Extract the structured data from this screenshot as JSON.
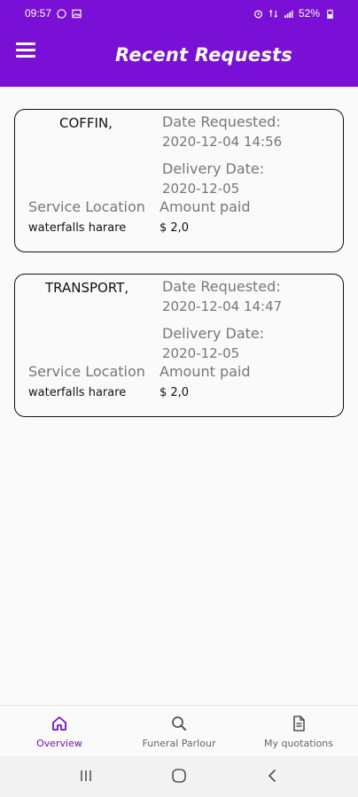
{
  "status_bar": {
    "time": "09:57",
    "battery": "52%",
    "icons_left": [
      "phone-icon",
      "whatsapp-icon",
      "image-icon"
    ],
    "icons_right": [
      "alarm-icon",
      "network-icon",
      "signal-icon",
      "battery-icon"
    ]
  },
  "app_bar": {
    "title": "Recent Requests",
    "menu_icon": "hamburger-menu-icon"
  },
  "requests": [
    {
      "service": "COFFIN,",
      "date_requested_label": "Date Requested:",
      "date_requested": "2020-12-04 14:56",
      "delivery_date_label": "Delivery Date:",
      "delivery_date": "2020-12-05",
      "service_location_label": "Service Location",
      "service_location": "waterfalls harare",
      "amount_paid_label": "Amount paid",
      "amount_paid": "$ 2,0"
    },
    {
      "service": "TRANSPORT,",
      "date_requested_label": "Date Requested:",
      "date_requested": "2020-12-04 14:47",
      "delivery_date_label": "Delivery Date:",
      "delivery_date": "2020-12-05",
      "service_location_label": "Service Location",
      "service_location": "waterfalls harare",
      "amount_paid_label": "Amount paid",
      "amount_paid": "$ 2,0"
    }
  ],
  "bottom_nav": {
    "items": [
      {
        "label": "Overview",
        "icon": "home-icon",
        "active": true
      },
      {
        "label": "Funeral Parlour",
        "icon": "search-icon",
        "active": false
      },
      {
        "label": "My quotations",
        "icon": "document-icon",
        "active": false
      }
    ]
  },
  "colors": {
    "primary": "#7a0fd6",
    "background": "#fafafa",
    "card_border": "#111111",
    "muted_text": "#777777"
  }
}
